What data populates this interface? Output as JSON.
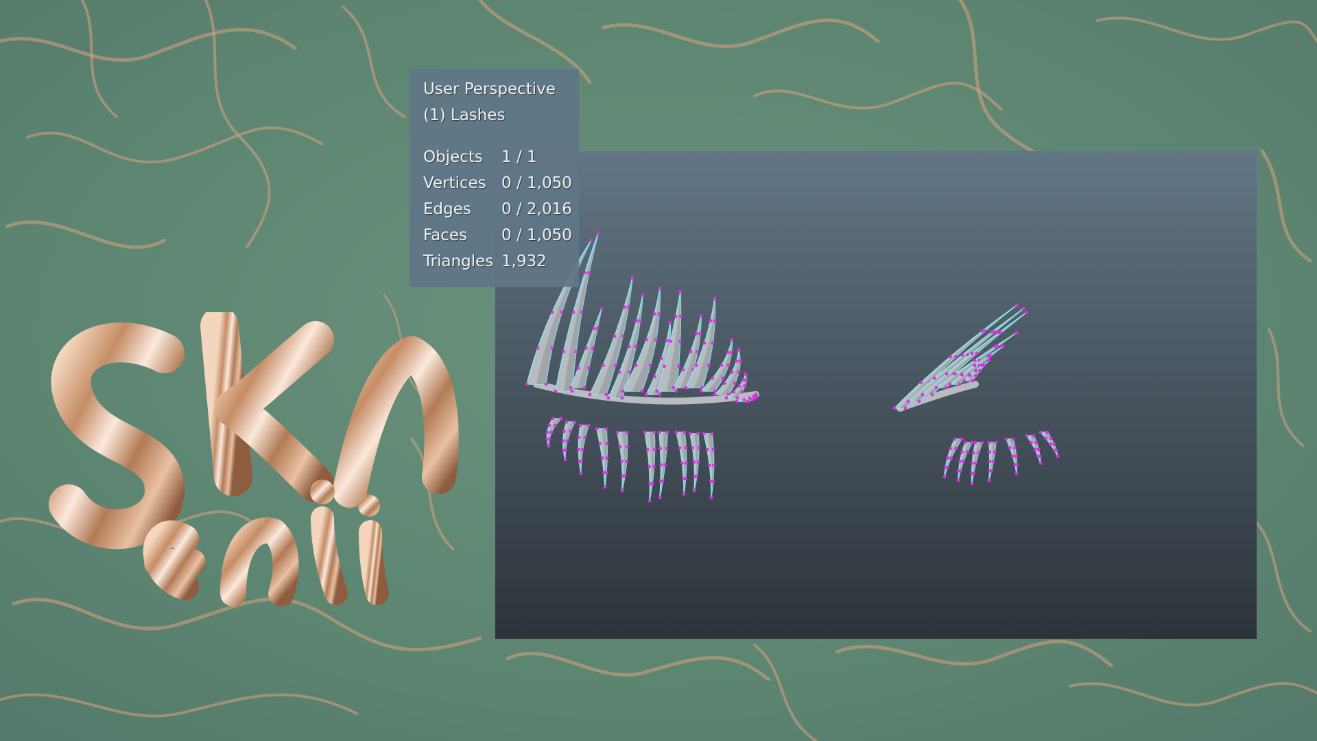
{
  "viewport": {
    "perspective_label": "User Perspective",
    "object_label": "(1) Lashes",
    "stats": [
      {
        "label": "Objects",
        "value": "1 / 1"
      },
      {
        "label": "Vertices",
        "value": "0 / 1,050"
      },
      {
        "label": "Edges",
        "value": "0 / 2,016"
      },
      {
        "label": "Faces",
        "value": "0 / 1,050"
      },
      {
        "label": "Triangles",
        "value": "1,932"
      }
    ]
  },
  "colors": {
    "vertex": "#e02ee6",
    "edge": "#8fe3ec",
    "lash_fill": "#b8bcc0",
    "lash_shade": "#8f969c"
  }
}
